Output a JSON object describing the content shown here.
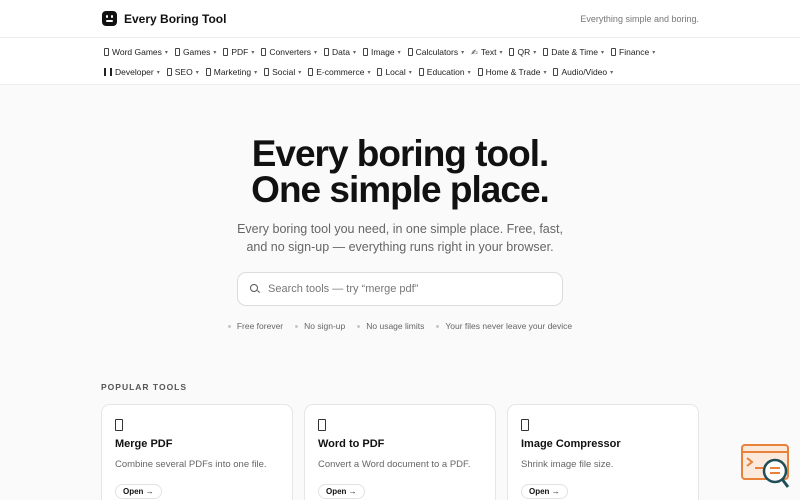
{
  "header": {
    "brand_name": "Every Boring Tool",
    "tagline": "Everything simple and boring."
  },
  "nav": {
    "row1": [
      {
        "label": "Word Games",
        "icon": "box-icon"
      },
      {
        "label": "Games",
        "icon": "box-icon"
      },
      {
        "label": "PDF",
        "icon": "box-icon"
      },
      {
        "label": "Converters",
        "icon": "box-icon"
      },
      {
        "label": "Data",
        "icon": "box-icon"
      },
      {
        "label": "Image",
        "icon": "box-icon"
      },
      {
        "label": "Calculators",
        "icon": "box-icon"
      },
      {
        "label": "Text",
        "icon": "pen-icon"
      },
      {
        "label": "QR",
        "icon": "box-icon"
      },
      {
        "label": "Date & Time",
        "icon": "box-icon"
      },
      {
        "label": "Finance",
        "icon": "box-icon"
      }
    ],
    "row2": [
      {
        "label": "Developer",
        "icon": "bars-icon"
      },
      {
        "label": "SEO",
        "icon": "box-icon"
      },
      {
        "label": "Marketing",
        "icon": "box-icon"
      },
      {
        "label": "Social",
        "icon": "box-icon"
      },
      {
        "label": "E-commerce",
        "icon": "box-icon"
      },
      {
        "label": "Local",
        "icon": "box-icon"
      },
      {
        "label": "Education",
        "icon": "box-icon"
      },
      {
        "label": "Home & Trade",
        "icon": "box-icon"
      },
      {
        "label": "Audio/Video",
        "icon": "box-icon"
      }
    ],
    "caret": "▾",
    "text_icon_glyph": "✍"
  },
  "hero": {
    "title_line1": "Every boring tool.",
    "title_line2": "One simple place.",
    "subtitle": "Every boring tool you need, in one simple place. Free, fast, and no sign-up — everything runs right in your browser.",
    "search_placeholder": "Search tools — try “merge pdf”"
  },
  "features": [
    "Free forever",
    "No sign-up",
    "No usage limits",
    "Your files never leave your device"
  ],
  "popular": {
    "heading": "POPULAR TOOLS",
    "cards": [
      {
        "title": "Merge PDF",
        "description": "Combine several PDFs into one file.",
        "button": "Open →"
      },
      {
        "title": "Word to PDF",
        "description": "Convert a Word document to a PDF.",
        "button": "Open →"
      },
      {
        "title": "Image Compressor",
        "description": "Shrink image file size.",
        "button": "Open →"
      }
    ]
  },
  "colors": {
    "accent": "#111111",
    "helper_orange": "#e8813a",
    "helper_teal": "#1f4e57"
  }
}
